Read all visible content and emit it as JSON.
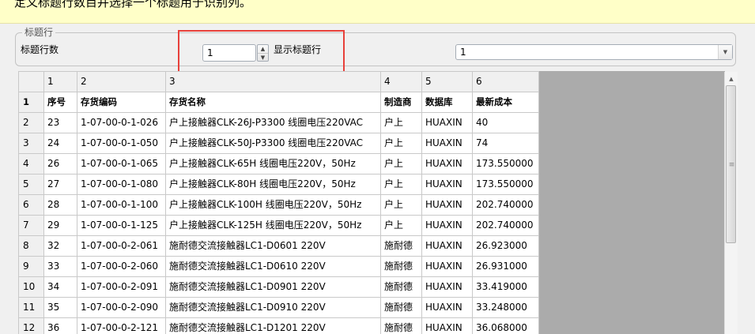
{
  "instruction": "定义标题行数目并选择一个标题用于识别列。",
  "header_group": {
    "title": "标题行",
    "row_count_label": "标题行数",
    "row_count_value": "1",
    "show_header_label": "显示标题行",
    "header_select_value": "1"
  },
  "grid": {
    "column_numbers": [
      "1",
      "2",
      "3",
      "4",
      "5",
      "6"
    ],
    "rows": [
      {
        "n": "1",
        "cells": [
          "序号",
          "存货编码",
          "存货名称",
          "制造商",
          "数据库",
          "最新成本"
        ]
      },
      {
        "n": "2",
        "cells": [
          "23",
          "1-07-00-0-1-026",
          "户上接触器CLK-26J-P3300  线圈电压220VAC",
          "户上",
          "HUAXIN",
          "40"
        ]
      },
      {
        "n": "3",
        "cells": [
          "24",
          "1-07-00-0-1-050",
          "户上接触器CLK-50J-P3300  线圈电压220VAC",
          "户上",
          "HUAXIN",
          "74"
        ]
      },
      {
        "n": "4",
        "cells": [
          "26",
          "1-07-00-0-1-065",
          "户上接触器CLK-65H      线圈电压220V，50Hz",
          "户上",
          "HUAXIN",
          "173.550000"
        ]
      },
      {
        "n": "5",
        "cells": [
          "27",
          "1-07-00-0-1-080",
          "户上接触器CLK-80H      线圈电压220V，50Hz",
          "户上",
          "HUAXIN",
          "173.550000"
        ]
      },
      {
        "n": "6",
        "cells": [
          "28",
          "1-07-00-0-1-100",
          "户上接触器CLK-100H     线圈电压220V，50Hz",
          "户上",
          "HUAXIN",
          "202.740000"
        ]
      },
      {
        "n": "7",
        "cells": [
          "29",
          "1-07-00-0-1-125",
          "户上接触器CLK-125H     线圈电压220V，50Hz",
          "户上",
          "HUAXIN",
          "202.740000"
        ]
      },
      {
        "n": "8",
        "cells": [
          "32",
          "1-07-00-0-2-061",
          "施耐德交流接触器LC1-D0601 220V",
          "施耐德",
          "HUAXIN",
          "26.923000"
        ]
      },
      {
        "n": "9",
        "cells": [
          "33",
          "1-07-00-0-2-060",
          "施耐德交流接触器LC1-D0610 220V",
          "施耐德",
          "HUAXIN",
          "26.931000"
        ]
      },
      {
        "n": "10",
        "cells": [
          "34",
          "1-07-00-0-2-091",
          "施耐德交流接触器LC1-D0901 220V",
          "施耐德",
          "HUAXIN",
          "33.419000"
        ]
      },
      {
        "n": "11",
        "cells": [
          "35",
          "1-07-00-0-2-090",
          "施耐德交流接触器LC1-D0910 220V",
          "施耐德",
          "HUAXIN",
          "33.248000"
        ]
      },
      {
        "n": "12",
        "cells": [
          "36",
          "1-07-00-0-2-121",
          "施耐德交流接触器LC1-D1201 220V",
          "施耐德",
          "HUAXIN",
          "36.068000"
        ]
      }
    ]
  },
  "colors": {
    "banner_bg": "#ffffc8",
    "highlight_box": "#e8413b",
    "grid_empty_bg": "#ababab",
    "header_cell_bg": "#f0f0f0"
  },
  "icons": {
    "spin_up": "chevron-up-icon",
    "spin_down": "chevron-down-icon",
    "dropdown": "chevron-down-icon",
    "scroll_up": "arrow-up-icon",
    "scroll_grip": "grip-icon"
  }
}
